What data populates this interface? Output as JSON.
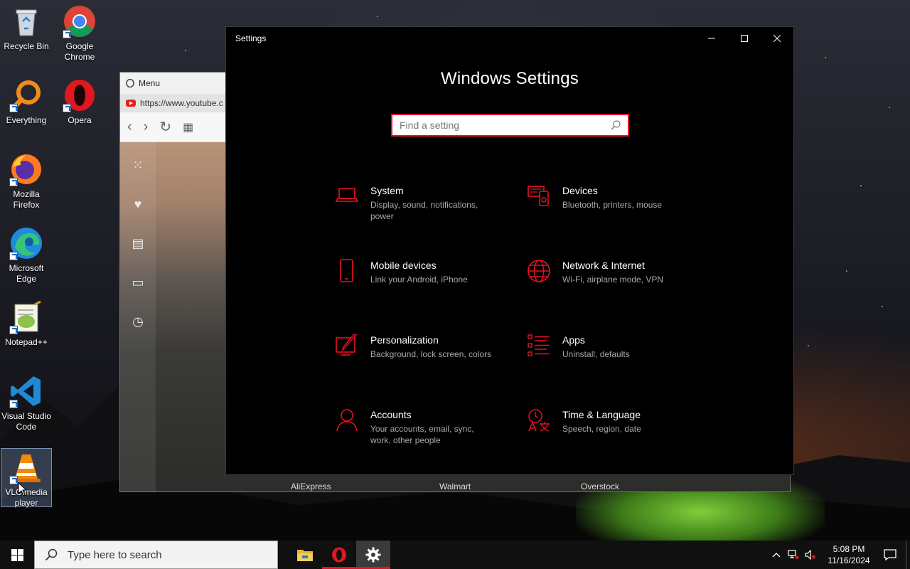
{
  "desktop": {
    "icons": [
      {
        "label": "Recycle Bin"
      },
      {
        "label": "Google Chrome"
      },
      {
        "label": "Everything"
      },
      {
        "label": "Opera"
      },
      {
        "label": "Mozilla Firefox"
      },
      {
        "label": "Microsoft Edge"
      },
      {
        "label": "Notepad++"
      },
      {
        "label": "Visual Studio Code"
      },
      {
        "label": "VLC media player"
      }
    ]
  },
  "opera": {
    "title": "Menu",
    "url": "https://www.youtube.c",
    "speed_dial": [
      "AliExpress",
      "Walmart",
      "Overstock"
    ]
  },
  "settings": {
    "window_title": "Settings",
    "heading": "Windows Settings",
    "search_placeholder": "Find a setting",
    "accent_color": "#e81123",
    "categories": [
      {
        "title": "System",
        "desc": "Display, sound, notifications, power",
        "icon": "laptop-icon"
      },
      {
        "title": "Devices",
        "desc": "Bluetooth, printers, mouse",
        "icon": "devices-icon"
      },
      {
        "title": "Mobile devices",
        "desc": "Link your Android, iPhone",
        "icon": "phone-icon"
      },
      {
        "title": "Network & Internet",
        "desc": "Wi-Fi, airplane mode, VPN",
        "icon": "globe-icon"
      },
      {
        "title": "Personalization",
        "desc": "Background, lock screen, colors",
        "icon": "paint-icon"
      },
      {
        "title": "Apps",
        "desc": "Uninstall, defaults",
        "icon": "apps-list-icon"
      },
      {
        "title": "Accounts",
        "desc": "Your accounts, email, sync, work, other people",
        "icon": "person-icon"
      },
      {
        "title": "Time & Language",
        "desc": "Speech, region, date",
        "icon": "time-language-icon"
      }
    ]
  },
  "taskbar": {
    "search_placeholder": "Type here to search",
    "time": "5:08 PM",
    "date": "11/16/2024"
  }
}
